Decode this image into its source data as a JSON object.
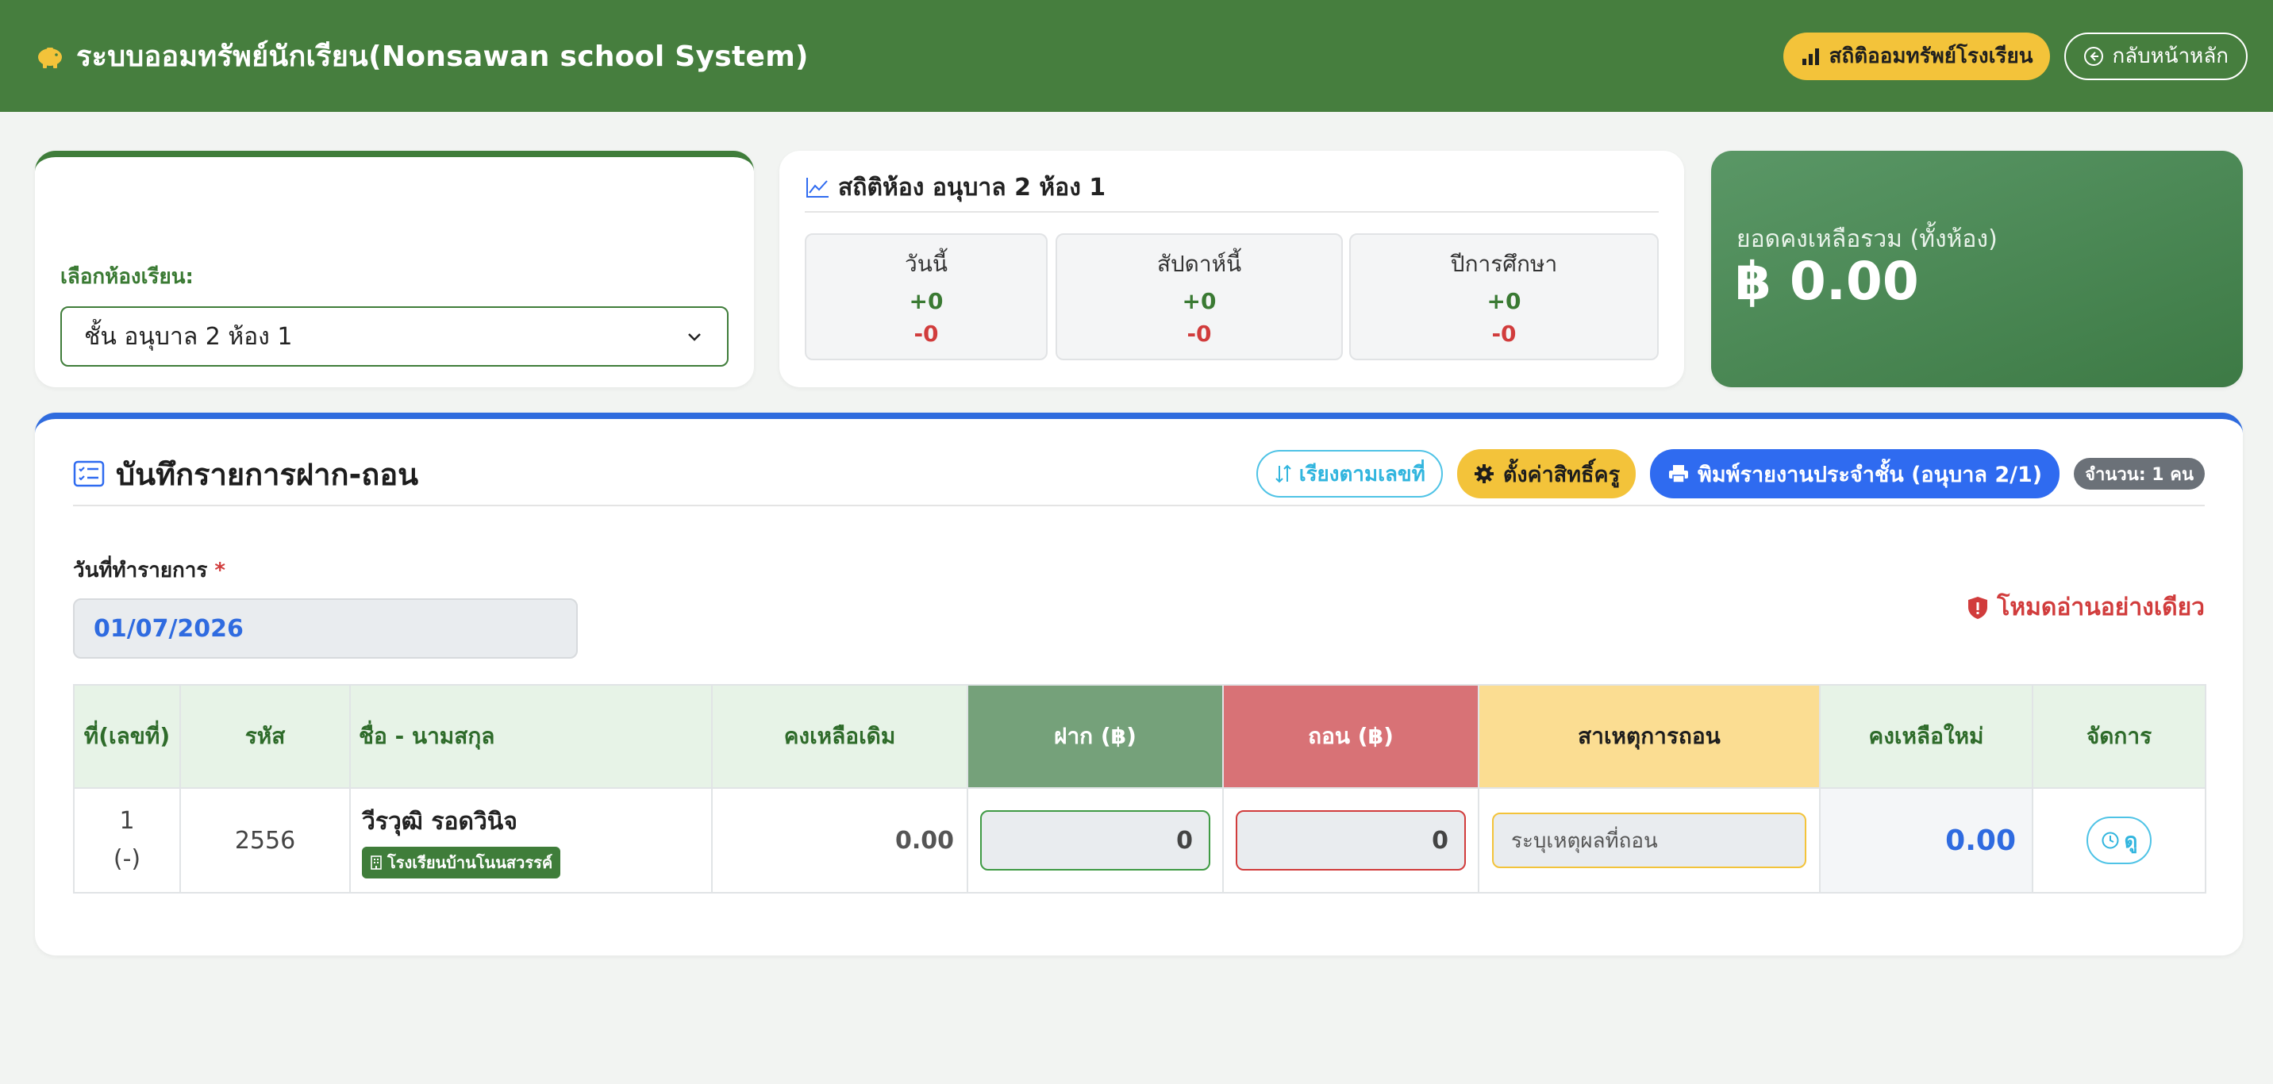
{
  "header": {
    "title": "ระบบออมทรัพย์นักเรียน(Nonsawan school System)",
    "stats_button": "สถิติออมทรัพย์โรงเรียน",
    "home_button": "กลับหน้าหลัก"
  },
  "class_select": {
    "label": "เลือกห้องเรียน:",
    "value": "ชั้น อนุบาล 2 ห้อง 1"
  },
  "class_stats": {
    "title": "สถิติห้อง อนุบาล 2 ห้อง 1",
    "boxes": [
      {
        "label": "วันนี้",
        "plus": "+0",
        "minus": "-0"
      },
      {
        "label": "สัปดาห์นี้",
        "plus": "+0",
        "minus": "-0"
      },
      {
        "label": "ปีการศึกษา",
        "plus": "+0",
        "minus": "-0"
      }
    ]
  },
  "balance": {
    "label": "ยอดคงเหลือรวม (ทั้งห้อง)",
    "amount": "฿ 0.00"
  },
  "transactions": {
    "title": "บันทึกรายการฝาก-ถอน",
    "sort_button": "เรียงตามเลขที่",
    "permission_button": "ตั้งค่าสิทธิ์ครู",
    "print_button": "พิมพ์รายงานประจำชั้น (อนุบาล 2/1)",
    "count_badge": "จำนวน: 1 คน",
    "date_label": "วันที่ทำรายการ",
    "date_required": "*",
    "date_value": "01/07/2026",
    "readonly_note": "โหมดอ่านอย่างเดียว",
    "columns": [
      "ที่(เลขที่)",
      "รหัส",
      "ชื่อ - นามสกุล",
      "คงเหลือเดิม",
      "ฝาก (฿)",
      "ถอน (฿)",
      "สาเหตุการถอน",
      "คงเหลือใหม่",
      "จัดการ"
    ],
    "rows": [
      {
        "no": "1",
        "no_sub": "(-)",
        "code": "2556",
        "name": "วีรวุฒิ รอดวินิจ",
        "school": "โรงเรียนบ้านโนนสวรรค์",
        "old_balance": "0.00",
        "deposit": "0",
        "withdraw": "0",
        "reason_placeholder": "ระบุเหตุผลที่ถอน",
        "new_balance": "0.00",
        "action": "ดู"
      }
    ]
  },
  "colors": {
    "header_green": "#467e3e",
    "accent_yellow": "#f3c33a",
    "accent_blue": "#2f6bf0",
    "danger_red": "#d13c3c"
  }
}
